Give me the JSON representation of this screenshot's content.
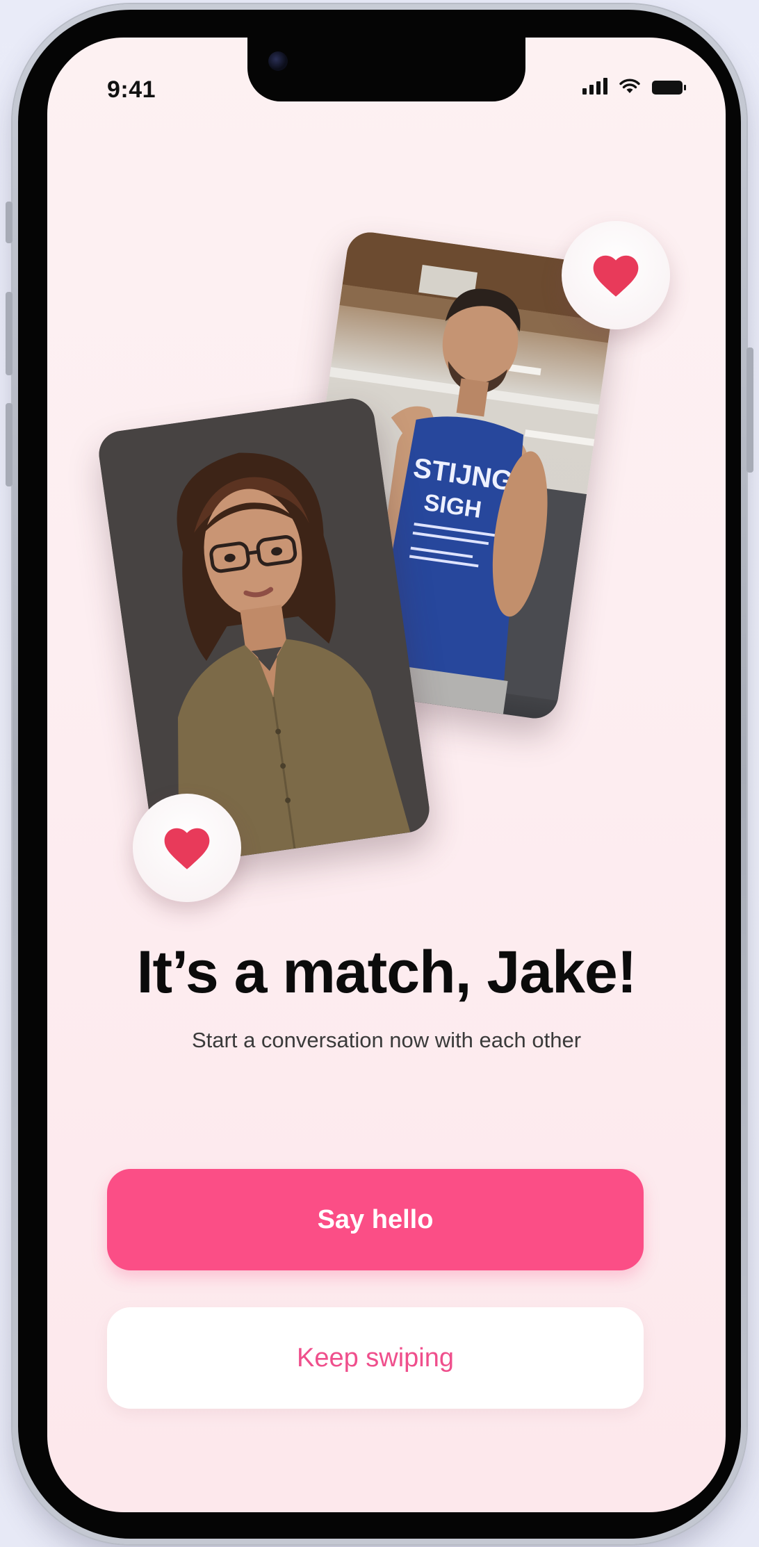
{
  "status_bar": {
    "time": "9:41",
    "signal_icon": "signal-icon",
    "wifi_icon": "wifi-icon",
    "battery_icon": "battery-icon"
  },
  "match": {
    "title": "It’s a match, Jake!",
    "subtitle": "Start a conversation now with each other",
    "heart_icon": "heart-icon",
    "heart_color": "#e83a5a"
  },
  "actions": {
    "primary_label": "Say hello",
    "secondary_label": "Keep swiping"
  },
  "colors": {
    "accent": "#fb4e86",
    "secondary_text": "#ef4f8c",
    "background": "#fdeef1"
  }
}
